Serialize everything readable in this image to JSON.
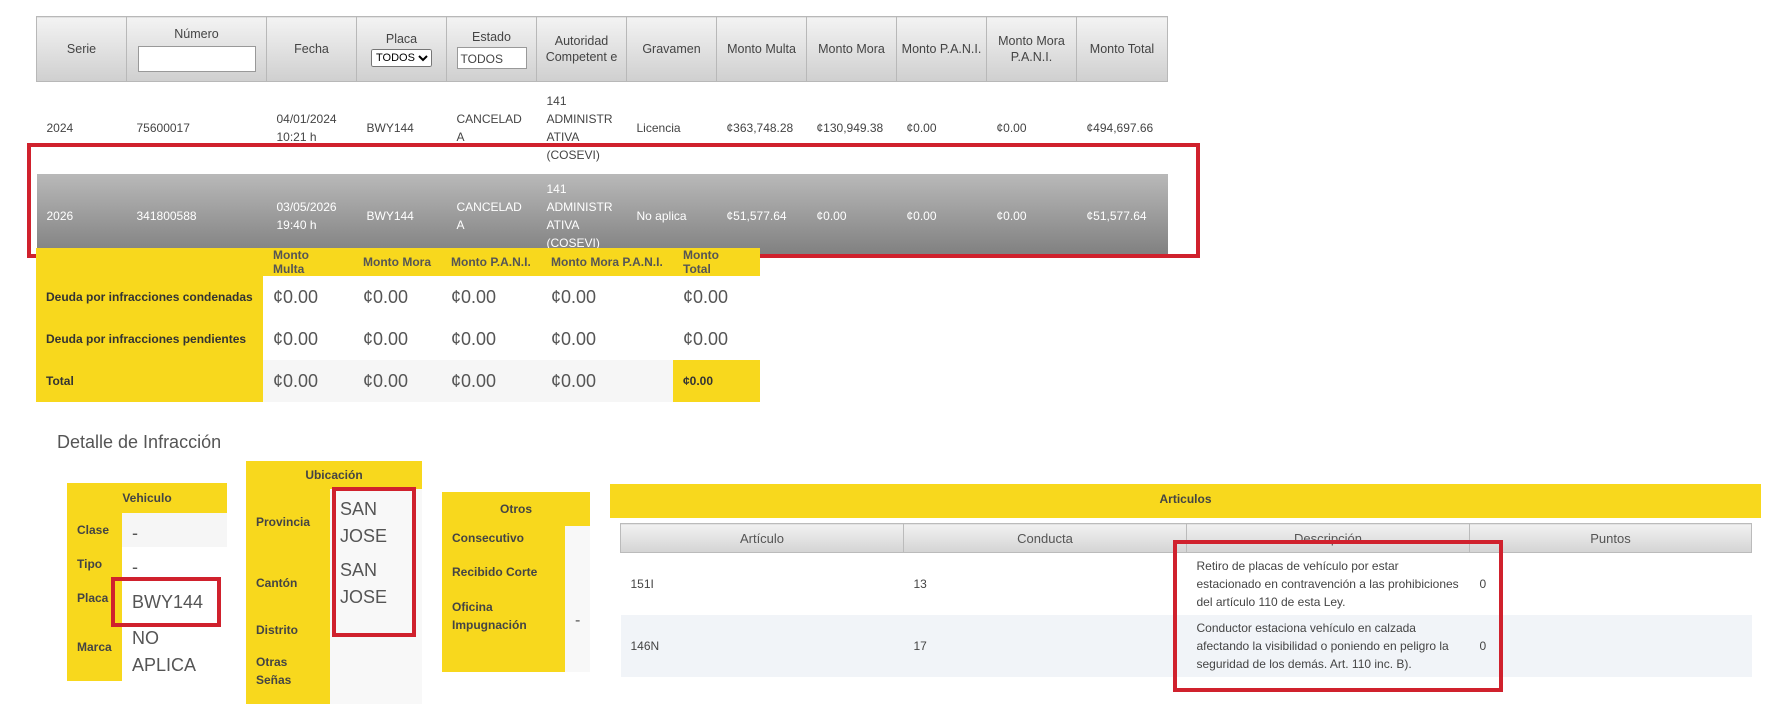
{
  "grid": {
    "headers": {
      "serie": "Serie",
      "numero": "Número",
      "fecha": "Fecha",
      "placa": "Placa",
      "estado": "Estado",
      "autoridad": "Autoridad Competent e",
      "gravamen": "Gravamen",
      "monto_multa": "Monto Multa",
      "monto_mora": "Monto Mora",
      "monto_pani": "Monto P.A.N.I.",
      "monto_mora_pani": "Monto Mora P.A.N.I.",
      "monto_total": "Monto Total"
    },
    "filters": {
      "numero_value": "",
      "placa_selected": "TODOS",
      "estado_value": "TODOS"
    },
    "rows": [
      {
        "serie": "2024",
        "numero": "75600017",
        "fecha": "04/01/2024",
        "hora": "10:21 h",
        "placa": "BWY144",
        "estado": "CANCELAD A",
        "autoridad": "141 ADMINISTR ATIVA (COSEVI)",
        "gravamen": "Licencia",
        "multa": "¢363,748.28",
        "mora": "¢130,949.38",
        "pani": "¢0.00",
        "mora_pani": "¢0.00",
        "total": "¢494,697.66"
      },
      {
        "serie": "2026",
        "numero": "341800588",
        "fecha": "03/05/2026",
        "hora": "19:40 h",
        "placa": "BWY144",
        "estado": "CANCELAD A",
        "autoridad": "141 ADMINISTR ATIVA (COSEVI)",
        "gravamen": "No aplica",
        "multa": "¢51,577.64",
        "mora": "¢0.00",
        "pani": "¢0.00",
        "mora_pani": "¢0.00",
        "total": "¢51,577.64"
      }
    ]
  },
  "summary": {
    "headers": [
      "Monto Multa",
      "Monto Mora",
      "Monto P.A.N.I.",
      "Monto Mora P.A.N.I.",
      "Monto Total"
    ],
    "rows": [
      {
        "label": "Deuda por infracciones condenadas",
        "values": [
          "¢0.00",
          "¢0.00",
          "¢0.00",
          "¢0.00",
          "¢0.00"
        ]
      },
      {
        "label": "Deuda por infracciones pendientes",
        "values": [
          "¢0.00",
          "¢0.00",
          "¢0.00",
          "¢0.00",
          "¢0.00"
        ]
      },
      {
        "label": "Total",
        "values": [
          "¢0.00",
          "¢0.00",
          "¢0.00",
          "¢0.00",
          "¢0.00"
        ]
      }
    ]
  },
  "detalle": {
    "title": "Detalle de Infracción",
    "vehiculo": {
      "header": "Vehiculo",
      "clase_label": "Clase",
      "clase": "-",
      "tipo_label": "Tipo",
      "tipo": "-",
      "placa_label": "Placa",
      "placa": "BWY144",
      "marca_label": "Marca",
      "marca": "NO APLICA"
    },
    "ubicacion": {
      "header": "Ubicación",
      "provincia_label": "Provincia",
      "provincia": "SAN JOSE",
      "canton_label": "Cantón",
      "canton": "SAN JOSE",
      "distrito_label": "Distrito",
      "otras_label": "Otras Señas"
    },
    "otros": {
      "header": "Otros",
      "consecutivo_label": "Consecutivo",
      "recibido_label": "Recibido Corte",
      "oficina_label": "Oficina Impugnación",
      "oficina": "-"
    },
    "articulos": {
      "header": "Articulos",
      "columns": {
        "articulo": "Artículo",
        "conducta": "Conducta",
        "descripcion": "Descripción",
        "puntos": "Puntos"
      },
      "rows": [
        {
          "articulo": "151I",
          "conducta": "13",
          "descripcion": "Retiro de placas de vehículo por estar estacionado en contravención a las prohibiciones del artículo 110 de esta Ley.",
          "puntos": "0"
        },
        {
          "articulo": "146N",
          "conducta": "17",
          "descripcion": "Conductor estaciona vehículo en calzada afectando la visibilidad o poniendo en peligro la seguridad de los demás. Art. 110 inc. B).",
          "puntos": "0"
        }
      ]
    }
  },
  "colors": {
    "accent_yellow": "#f8d81d",
    "highlight_red": "#d0212d",
    "selected_row_gray": "#8a8a8a"
  }
}
